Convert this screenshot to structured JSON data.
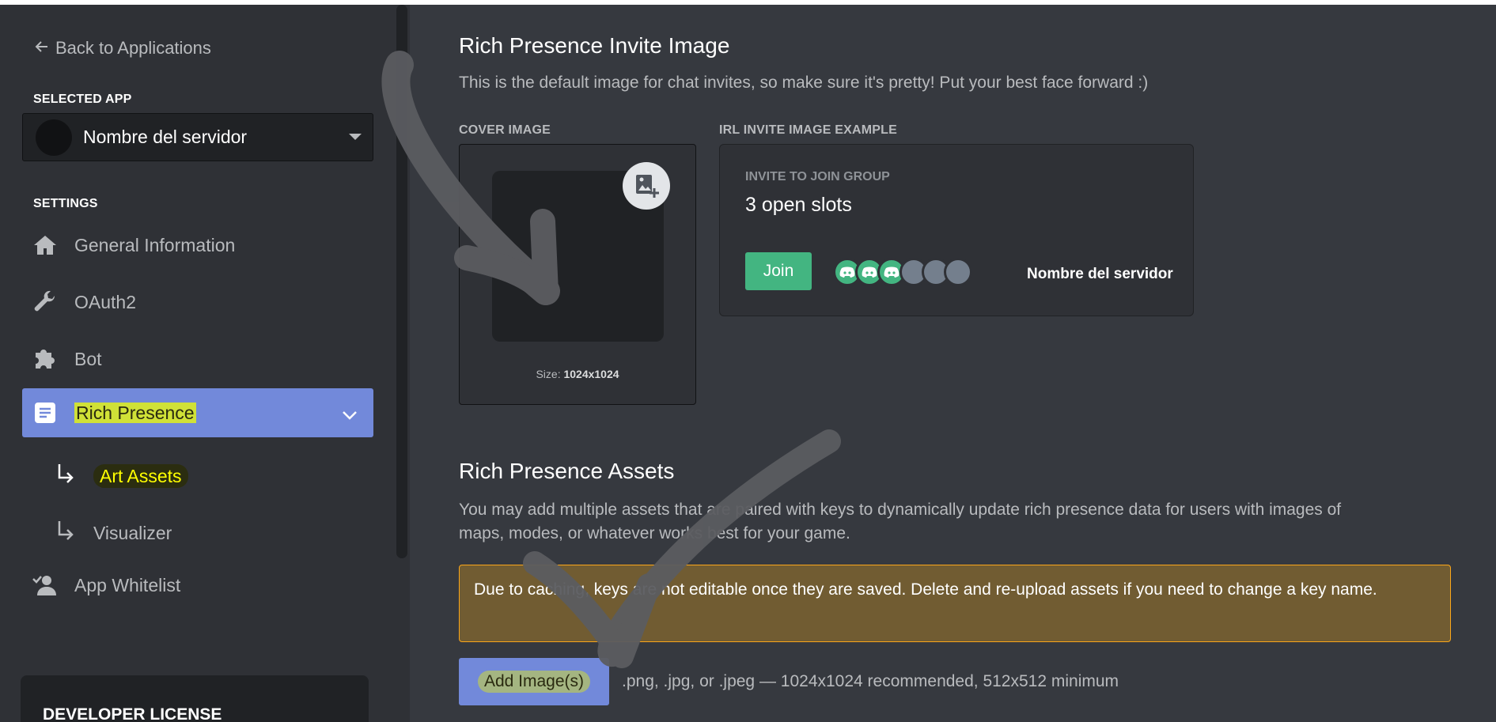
{
  "sidebar": {
    "back_label": "Back to Applications",
    "selected_app_label": "SELECTED APP",
    "selected_app_name": "Nombre del servidor",
    "settings_label": "SETTINGS",
    "items": [
      {
        "label": "General Information",
        "icon": "home-icon"
      },
      {
        "label": "OAuth2",
        "icon": "wrench-icon"
      },
      {
        "label": "Bot",
        "icon": "puzzle-icon"
      },
      {
        "label": "Rich Presence",
        "icon": "document-icon"
      },
      {
        "label": "App Whitelist",
        "icon": "user-check-icon"
      }
    ],
    "sub_items": [
      {
        "label": "Art Assets"
      },
      {
        "label": "Visualizer"
      }
    ],
    "developer_license": "DEVELOPER LICENSE"
  },
  "main": {
    "invite_title": "Rich Presence Invite Image",
    "invite_desc": "This is the default image for chat invites, so make sure it's pretty! Put your best face forward :)",
    "cover_label": "COVER IMAGE",
    "cover_size_prefix": "Size:",
    "cover_size_value": "1024x1024",
    "example_label": "IRL INVITE IMAGE EXAMPLE",
    "invite_card": {
      "caption": "INVITE TO JOIN GROUP",
      "slots": "3 open slots",
      "join_label": "Join",
      "server_name": "Nombre del servidor"
    },
    "assets_title": "Rich Presence Assets",
    "assets_desc_line1": "You may add multiple assets that are paired with keys to dynamically update rich presence data for users with images of",
    "assets_desc_line2": "maps, modes, or whatever works best for your game.",
    "notice_text": "Due to caching, keys are not editable once they are saved. Delete and re-upload assets if you need to change a key name.",
    "add_button_label": "Add Image(s)",
    "add_hint": ".png, .jpg, or .jpeg — 1024x1024 recommended, 512x512 minimum"
  },
  "colors": {
    "sidebar_bg": "#2f3136",
    "main_bg": "#36393f",
    "accent": "#7289da",
    "join_green": "#43b581",
    "notice_bg": "#715c32",
    "notice_border": "#faa61a",
    "highlight": "#f0ff00"
  }
}
